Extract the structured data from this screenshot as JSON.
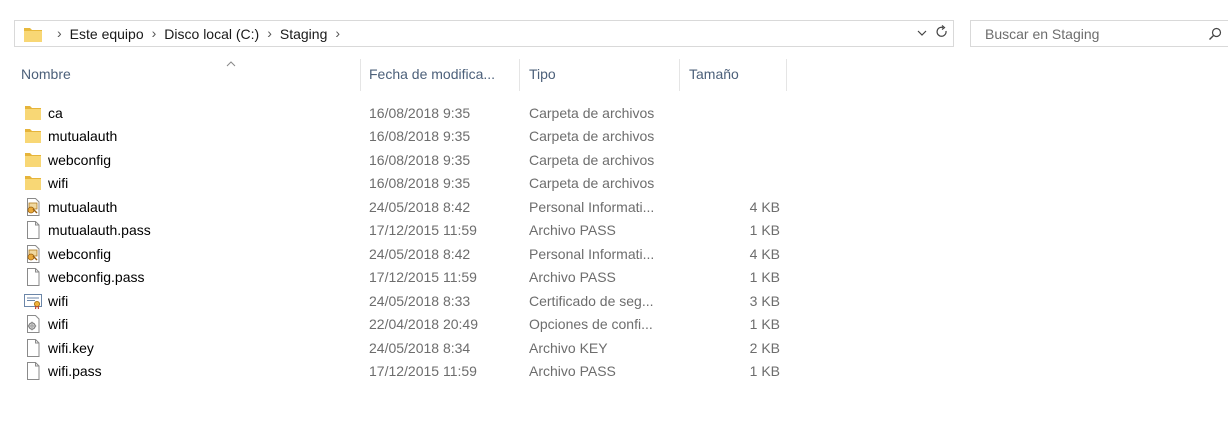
{
  "address": {
    "crumbs": [
      "Este equipo",
      "Disco local (C:)",
      "Staging"
    ]
  },
  "search": {
    "placeholder": "Buscar en Staging"
  },
  "columns": {
    "name": "Nombre",
    "date": "Fecha de modifica...",
    "type": "Tipo",
    "size": "Tamaño"
  },
  "files": [
    {
      "name": "ca",
      "date": "16/08/2018 9:35",
      "type": "Carpeta de archivos",
      "size": "",
      "icon": "folder-icon"
    },
    {
      "name": "mutualauth",
      "date": "16/08/2018 9:35",
      "type": "Carpeta de archivos",
      "size": "",
      "icon": "folder-icon"
    },
    {
      "name": "webconfig",
      "date": "16/08/2018 9:35",
      "type": "Carpeta de archivos",
      "size": "",
      "icon": "folder-icon"
    },
    {
      "name": "wifi",
      "date": "16/08/2018 9:35",
      "type": "Carpeta de archivos",
      "size": "",
      "icon": "folder-icon"
    },
    {
      "name": "mutualauth",
      "date": "24/05/2018 8:42",
      "type": "Personal Informati...",
      "size": "4 KB",
      "icon": "pfx-certificate-icon"
    },
    {
      "name": "mutualauth.pass",
      "date": "17/12/2015 11:59",
      "type": "Archivo PASS",
      "size": "1 KB",
      "icon": "blank-file-icon"
    },
    {
      "name": "webconfig",
      "date": "24/05/2018 8:42",
      "type": "Personal Informati...",
      "size": "4 KB",
      "icon": "pfx-certificate-icon"
    },
    {
      "name": "webconfig.pass",
      "date": "17/12/2015 11:59",
      "type": "Archivo PASS",
      "size": "1 KB",
      "icon": "blank-file-icon"
    },
    {
      "name": "wifi",
      "date": "24/05/2018 8:33",
      "type": "Certificado de seg...",
      "size": "3 KB",
      "icon": "security-certificate-icon"
    },
    {
      "name": "wifi",
      "date": "22/04/2018 20:49",
      "type": "Opciones de confi...",
      "size": "1 KB",
      "icon": "config-settings-icon"
    },
    {
      "name": "wifi.key",
      "date": "24/05/2018 8:34",
      "type": "Archivo KEY",
      "size": "2 KB",
      "icon": "blank-file-icon"
    },
    {
      "name": "wifi.pass",
      "date": "17/12/2015 11:59",
      "type": "Archivo PASS",
      "size": "1 KB",
      "icon": "blank-file-icon"
    }
  ]
}
